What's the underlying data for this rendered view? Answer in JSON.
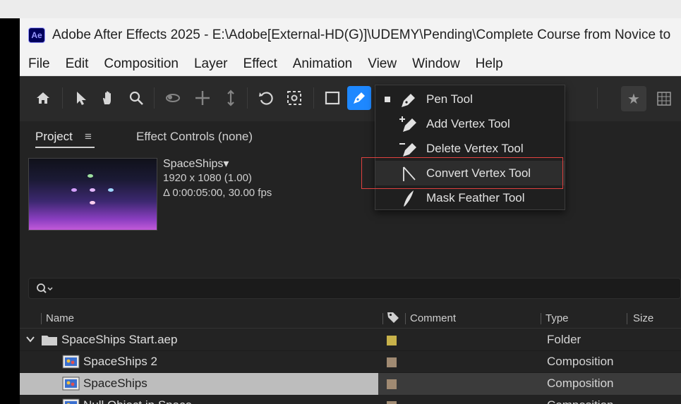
{
  "window": {
    "app_logo": "Ae",
    "title": "Adobe After Effects 2025 - E:\\Adobe[External-HD(G)]\\UDEMY\\Pending\\Complete Course from Novice to"
  },
  "menu": [
    "File",
    "Edit",
    "Composition",
    "Layer",
    "Effect",
    "Animation",
    "View",
    "Window",
    "Help"
  ],
  "toolbar": {
    "tools": [
      "home-icon",
      "selection-tool-icon",
      "hand-tool-icon",
      "zoom-tool-icon",
      "orbit-camera-icon",
      "pan-camera-icon",
      "dolly-camera-icon",
      "rotation-tool-icon",
      "anchor-point-icon",
      "shape-tool-icon",
      "pen-tool-icon"
    ],
    "active_tool": "pen-tool-icon",
    "star": "★"
  },
  "pen_menu": {
    "items": [
      {
        "label": "Pen Tool",
        "icon": "pen-icon",
        "selected": true
      },
      {
        "label": "Add Vertex Tool",
        "icon": "add-vertex-icon",
        "selected": false
      },
      {
        "label": "Delete Vertex Tool",
        "icon": "delete-vertex-icon",
        "selected": false
      },
      {
        "label": "Convert Vertex Tool",
        "icon": "convert-vertex-icon",
        "selected": false
      },
      {
        "label": "Mask Feather Tool",
        "icon": "mask-feather-icon",
        "selected": false
      }
    ],
    "highlight_color": "#e0413f"
  },
  "panel": {
    "tab_project": "Project",
    "tab_menu": "≡",
    "tab_effect_controls": "Effect Controls (none)"
  },
  "comp": {
    "name": "SpaceShips",
    "name_arrow": "▾",
    "resolution": "1920 x 1080 (1.00)",
    "duration": "Δ 0:00:05:00, 30.00 fps"
  },
  "search": {
    "icon": "search-icon",
    "value": ""
  },
  "columns": {
    "name": "Name",
    "label_icon": "tag-icon",
    "comment": "Comment",
    "type": "Type",
    "size": "Size"
  },
  "rows": [
    {
      "name": "SpaceShips Start.aep",
      "type": "Folder",
      "icon": "folder-icon",
      "color": "#c8b24a",
      "expanded": true
    },
    {
      "name": "SpaceShips 2",
      "type": "Composition",
      "icon": "composition-icon",
      "color": "#a08a72"
    },
    {
      "name": "SpaceShips",
      "type": "Composition",
      "icon": "composition-icon",
      "color": "#a08a72",
      "selected": true
    },
    {
      "name": "Null Object in Space",
      "type": "Composition",
      "icon": "composition-icon",
      "color": "#a08a72"
    }
  ]
}
